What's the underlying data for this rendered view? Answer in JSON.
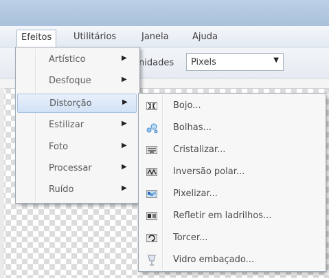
{
  "menubar": {
    "items": [
      {
        "label": "Efeitos"
      },
      {
        "label": "Utilitários"
      },
      {
        "label": "Janela"
      },
      {
        "label": "Ajuda"
      }
    ]
  },
  "toolbar": {
    "units_label": "nidades",
    "units_value": "Pixels"
  },
  "effects_menu": {
    "items": [
      {
        "label": "Artístico"
      },
      {
        "label": "Desfoque"
      },
      {
        "label": "Distorção"
      },
      {
        "label": "Estilizar"
      },
      {
        "label": "Foto"
      },
      {
        "label": "Processar"
      },
      {
        "label": "Ruído"
      }
    ],
    "highlighted": "Distorção"
  },
  "distortion_submenu": {
    "items": [
      {
        "label": "Bojo...",
        "icon": "bulge-icon"
      },
      {
        "label": "Bolhas...",
        "icon": "bubbles-icon"
      },
      {
        "label": "Cristalizar...",
        "icon": "crystallize-icon"
      },
      {
        "label": "Inversão polar...",
        "icon": "polar-inversion-icon"
      },
      {
        "label": "Pixelizar...",
        "icon": "pixelate-icon"
      },
      {
        "label": "Refletir em ladrilhos...",
        "icon": "tile-reflection-icon"
      },
      {
        "label": "Torcer...",
        "icon": "twist-icon"
      },
      {
        "label": "Vidro embaçado...",
        "icon": "frosted-glass-icon"
      }
    ]
  },
  "colors": {
    "highlight": "#d2e2f6",
    "menu_bg": "#f6f6f6",
    "titlebar": "#b6cbe2"
  }
}
